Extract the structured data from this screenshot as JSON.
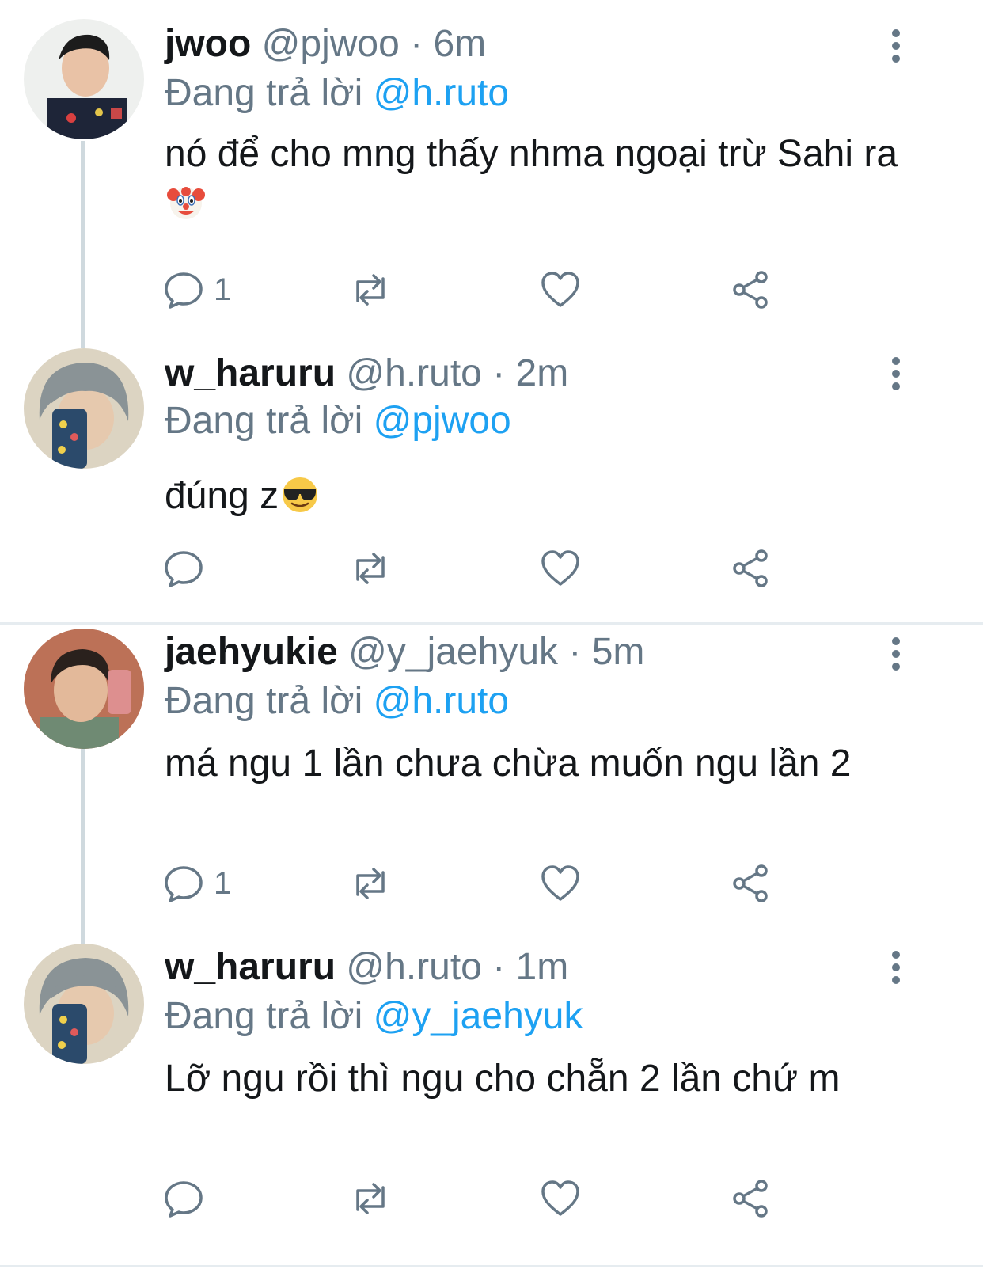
{
  "colors": {
    "accent": "#1da1f2",
    "muted": "#657786",
    "text": "#14171a",
    "line": "#cfd9de"
  },
  "tweets": [
    {
      "name": "jwoo",
      "handle": "@pjwoo",
      "time": "6m",
      "reply_prefix": "Đang trả lời",
      "reply_to": "@h.ruto",
      "text": "nó để cho mng thấy nhma ngoại trừ Sahi ra",
      "emoji": "clown-face",
      "reply_count": "1"
    },
    {
      "name": "w_haruru",
      "handle": "@h.ruto",
      "time": "2m",
      "reply_prefix": "Đang trả lời",
      "reply_to": "@pjwoo",
      "text": "đúng z",
      "emoji": "sunglasses-face",
      "reply_count": ""
    },
    {
      "name": "jaehyukie",
      "handle": "@y_jaehyuk",
      "time": "5m",
      "reply_prefix": "Đang trả lời",
      "reply_to": "@h.ruto",
      "text": "má ngu 1 lần chưa chừa muốn ngu lần 2",
      "emoji": "",
      "reply_count": "1"
    },
    {
      "name": "w_haruru",
      "handle": "@h.ruto",
      "time": "1m",
      "reply_prefix": "Đang trả lời",
      "reply_to": "@y_jaehyuk",
      "text": "Lỡ ngu rồi thì ngu cho chẵn 2 lần chứ m",
      "emoji": "",
      "reply_count": ""
    }
  ],
  "separator": "·",
  "icons": {
    "reply": "reply-icon",
    "retweet": "retweet-icon",
    "like": "heart-icon",
    "share": "share-icon",
    "more": "more-vertical-icon"
  }
}
